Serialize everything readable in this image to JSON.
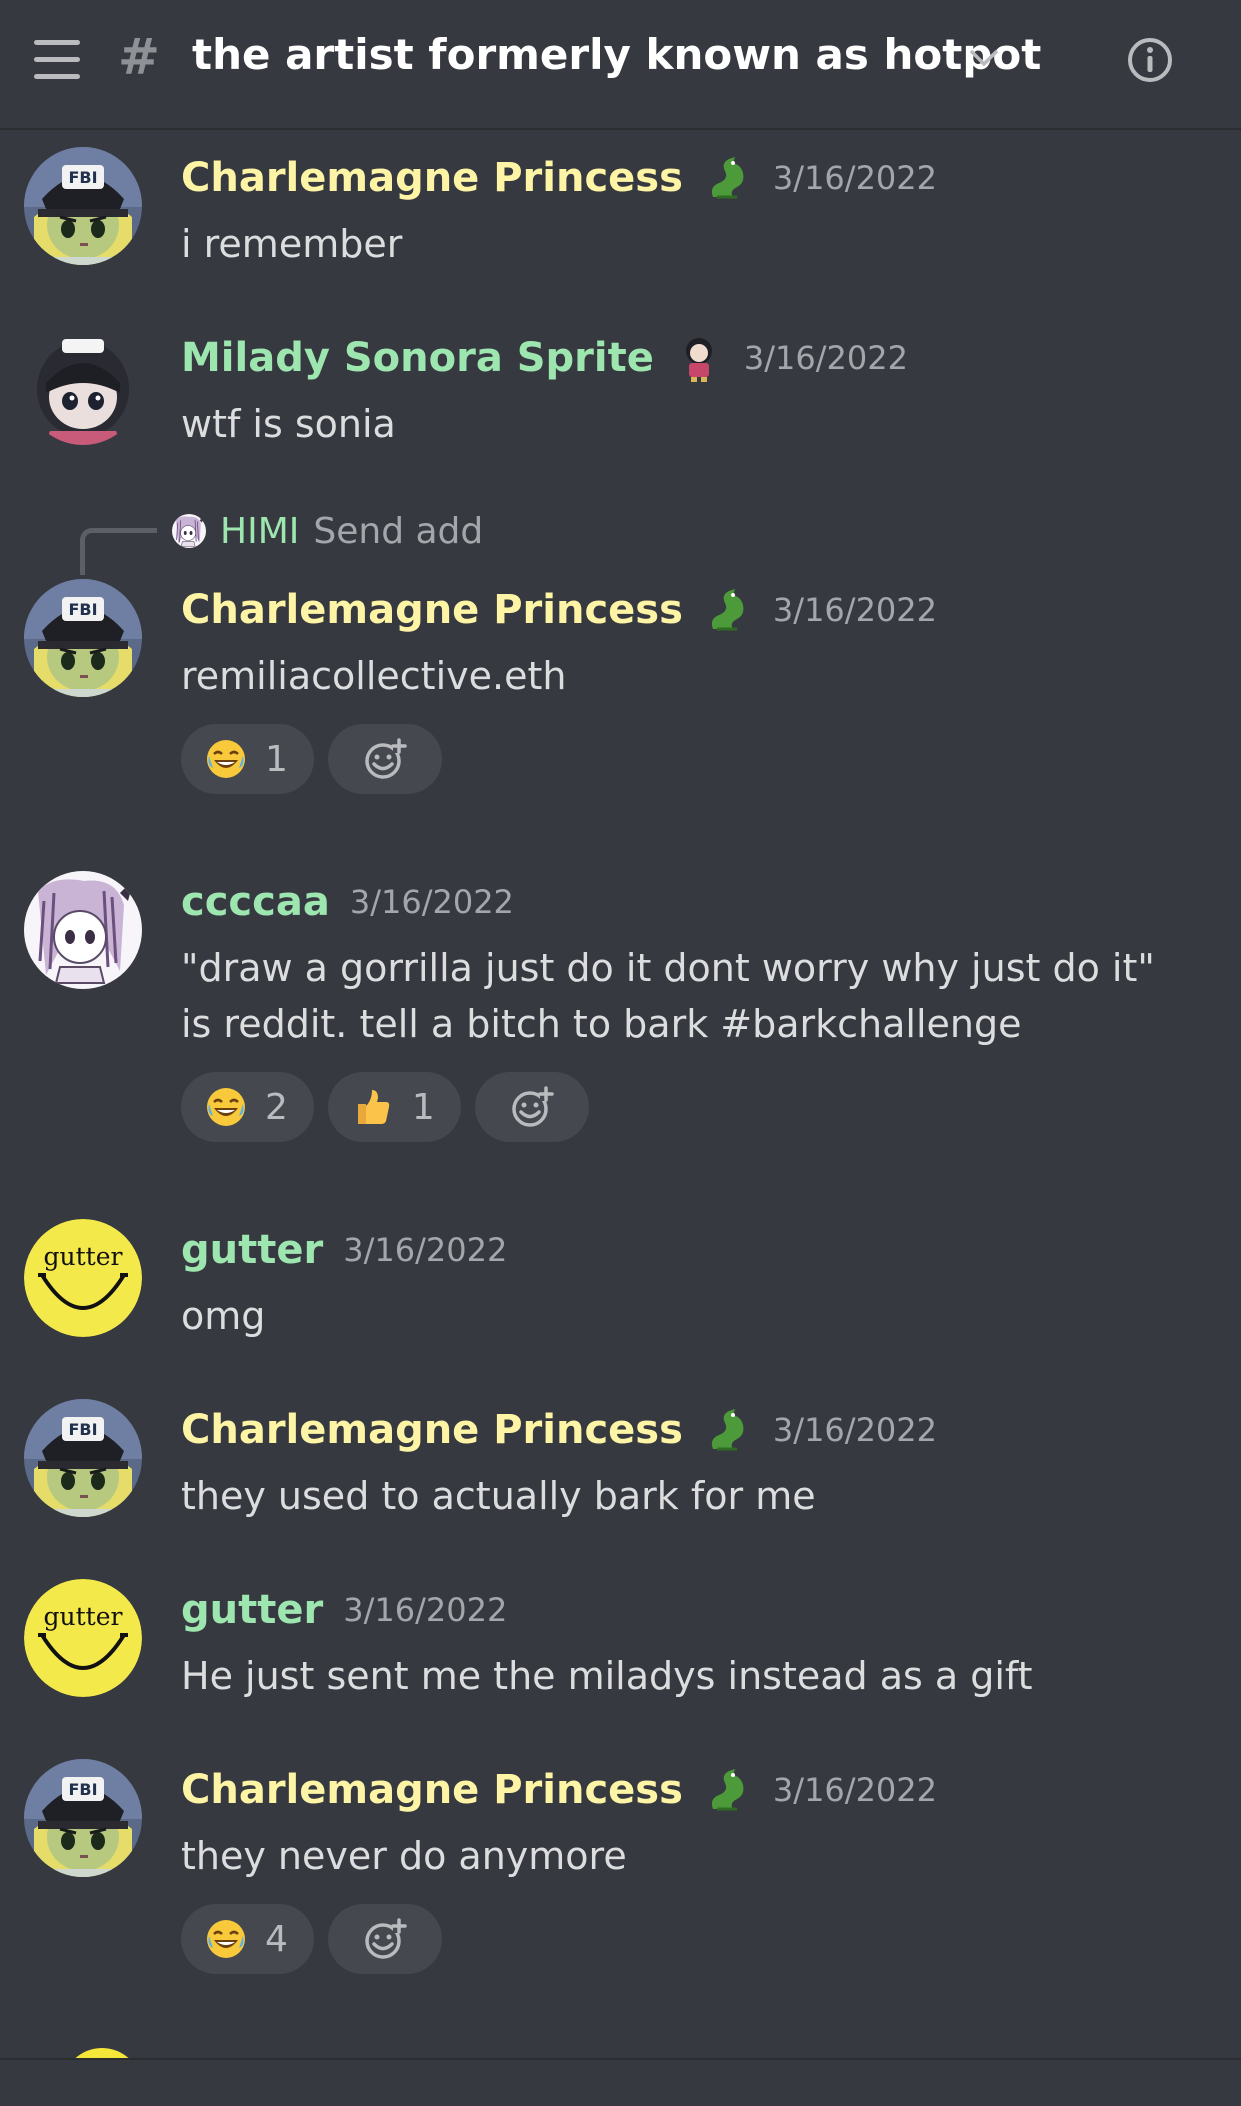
{
  "header": {
    "channel_name": "the artist formerly known as hotpot",
    "hash_symbol": "#"
  },
  "messages": [
    {
      "author": "Charlemagne Princess",
      "time": "3/16/2022",
      "text": "i remember"
    },
    {
      "author": "Milady Sonora Sprite",
      "time": "3/16/2022",
      "text": "wtf is sonia"
    },
    {
      "author": "Charlemagne Princess",
      "time": "3/16/2022",
      "text": "remiliacollective.eth",
      "reply": {
        "author": "HIMI",
        "text": "Send add"
      },
      "reactions": [
        {
          "emoji": "joy",
          "count": "1"
        }
      ]
    },
    {
      "author": "ccccaa",
      "time": "3/16/2022",
      "text_line1": "\"draw a gorrilla just do it dont worry why just do it\"",
      "text_line2": "is reddit. tell a bitch to bark #barkchallenge",
      "reactions": [
        {
          "emoji": "joy",
          "count": "2"
        },
        {
          "emoji": "thumbs-up",
          "count": "1"
        }
      ]
    },
    {
      "author": "gutter",
      "time": "3/16/2022",
      "text": "omg"
    },
    {
      "author": "Charlemagne Princess",
      "time": "3/16/2022",
      "text": "they used to actually bark for me"
    },
    {
      "author": "gutter",
      "time": "3/16/2022",
      "text": "He just sent me the miladys instead as a gift"
    },
    {
      "author": "Charlemagne Princess",
      "time": "3/16/2022",
      "text": "they never do anymore",
      "reactions": [
        {
          "emoji": "joy",
          "count": "4"
        }
      ]
    }
  ],
  "avatars": {
    "gutter_text": "gutter"
  },
  "colors": {
    "background": "#36393f",
    "author_yellow": "#fdf4a5",
    "author_green": "#9ee6b0",
    "timestamp": "#a3a6aa",
    "reaction_bg": "#45484f"
  }
}
